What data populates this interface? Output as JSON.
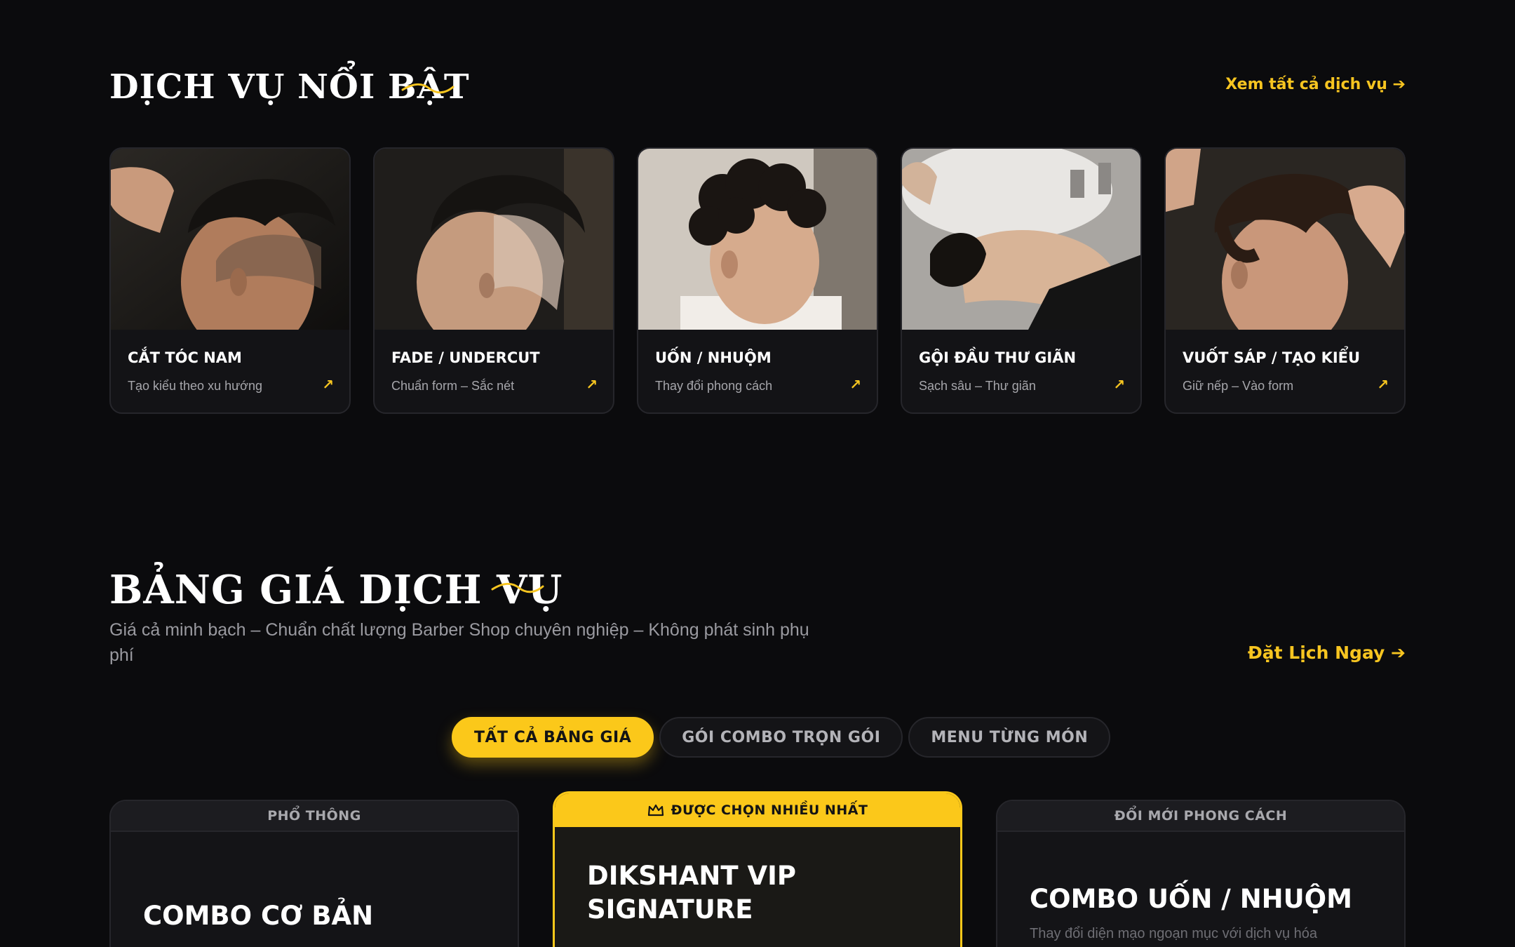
{
  "featured": {
    "title": "DỊCH VỤ NỔI BẬT",
    "see_all": "Xem tất cả dịch vụ ➔",
    "cards": [
      {
        "title": "CẮT TÓC NAM",
        "subtitle": "Tạo kiểu theo xu hướng",
        "arrow": "↗"
      },
      {
        "title": "FADE / UNDERCUT",
        "subtitle": "Chuẩn form – Sắc nét",
        "arrow": "↗"
      },
      {
        "title": "UỐN / NHUỘM",
        "subtitle": "Thay đổi phong cách",
        "arrow": "↗"
      },
      {
        "title": "GỘI ĐẦU THƯ GIÃN",
        "subtitle": "Sạch sâu – Thư giãn",
        "arrow": "↗"
      },
      {
        "title": "VUỐT SÁP / TẠO KIỂU",
        "subtitle": "Giữ nếp – Vào form",
        "arrow": "↗"
      }
    ]
  },
  "pricing": {
    "title": "BẢNG GIÁ DỊCH VỤ",
    "subtitle": "Giá cả minh bạch – Chuẩn chất lượng Barber Shop chuyên nghiệp – Không phát sinh phụ phí",
    "book_link": "Đặt Lịch Ngay ➔",
    "tabs": [
      {
        "label": "TẤT CẢ BẢNG GIÁ",
        "active": true
      },
      {
        "label": "GÓI COMBO TRỌN GÓI",
        "active": false
      },
      {
        "label": "MENU TỪNG MÓN",
        "active": false
      }
    ],
    "plans": [
      {
        "ribbon": "PHỔ THÔNG",
        "title": "COMBO CƠ BẢN"
      },
      {
        "ribbon": "ĐƯỢC CHỌN NHIỀU NHẤT",
        "title_line1": "DIKSHANT VIP",
        "title_line2": "SIGNATURE"
      },
      {
        "ribbon": "ĐỔI MỚI PHONG CÁCH",
        "title": "COMBO UỐN / NHUỘM",
        "description": "Thay đổi diện mạo ngoạn mục với dịch vụ hóa"
      }
    ]
  },
  "colors": {
    "background": "#0b0b0d",
    "accent": "#fbc81a",
    "card": "#131316"
  }
}
